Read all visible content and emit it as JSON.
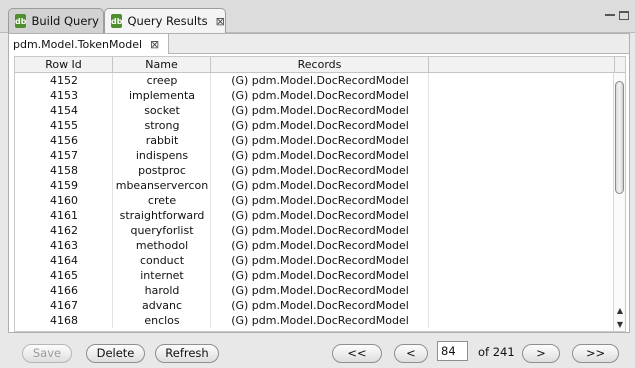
{
  "tabs": [
    {
      "label": "Build Query",
      "icon": "db"
    },
    {
      "label": "Query Results",
      "icon": "db",
      "close": "⊠"
    }
  ],
  "subtab": {
    "label": "pdm.Model.TokenModel",
    "close": "⊠"
  },
  "table": {
    "columns": [
      "Row Id",
      "Name",
      "Records"
    ],
    "rows": [
      [
        "4152",
        "creep",
        "(G) pdm.Model.DocRecordModel"
      ],
      [
        "4153",
        "implementa",
        "(G) pdm.Model.DocRecordModel"
      ],
      [
        "4154",
        "socket",
        "(G) pdm.Model.DocRecordModel"
      ],
      [
        "4155",
        "strong",
        "(G) pdm.Model.DocRecordModel"
      ],
      [
        "4156",
        "rabbit",
        "(G) pdm.Model.DocRecordModel"
      ],
      [
        "4157",
        "indispens",
        "(G) pdm.Model.DocRecordModel"
      ],
      [
        "4158",
        "postproc",
        "(G) pdm.Model.DocRecordModel"
      ],
      [
        "4159",
        "mbeanservercon",
        "(G) pdm.Model.DocRecordModel"
      ],
      [
        "4160",
        "crete",
        "(G) pdm.Model.DocRecordModel"
      ],
      [
        "4161",
        "straightforward",
        "(G) pdm.Model.DocRecordModel"
      ],
      [
        "4162",
        "queryforlist",
        "(G) pdm.Model.DocRecordModel"
      ],
      [
        "4163",
        "methodol",
        "(G) pdm.Model.DocRecordModel"
      ],
      [
        "4164",
        "conduct",
        "(G) pdm.Model.DocRecordModel"
      ],
      [
        "4165",
        "internet",
        "(G) pdm.Model.DocRecordModel"
      ],
      [
        "4166",
        "harold",
        "(G) pdm.Model.DocRecordModel"
      ],
      [
        "4167",
        "advanc",
        "(G) pdm.Model.DocRecordModel"
      ],
      [
        "4168",
        "enclos",
        "(G) pdm.Model.DocRecordModel"
      ]
    ]
  },
  "buttons": {
    "save": "Save",
    "delete": "Delete",
    "refresh": "Refresh",
    "first": "<<",
    "prev": "<",
    "next": ">",
    "last": ">>"
  },
  "pager": {
    "page": "84",
    "total": "of 241"
  }
}
